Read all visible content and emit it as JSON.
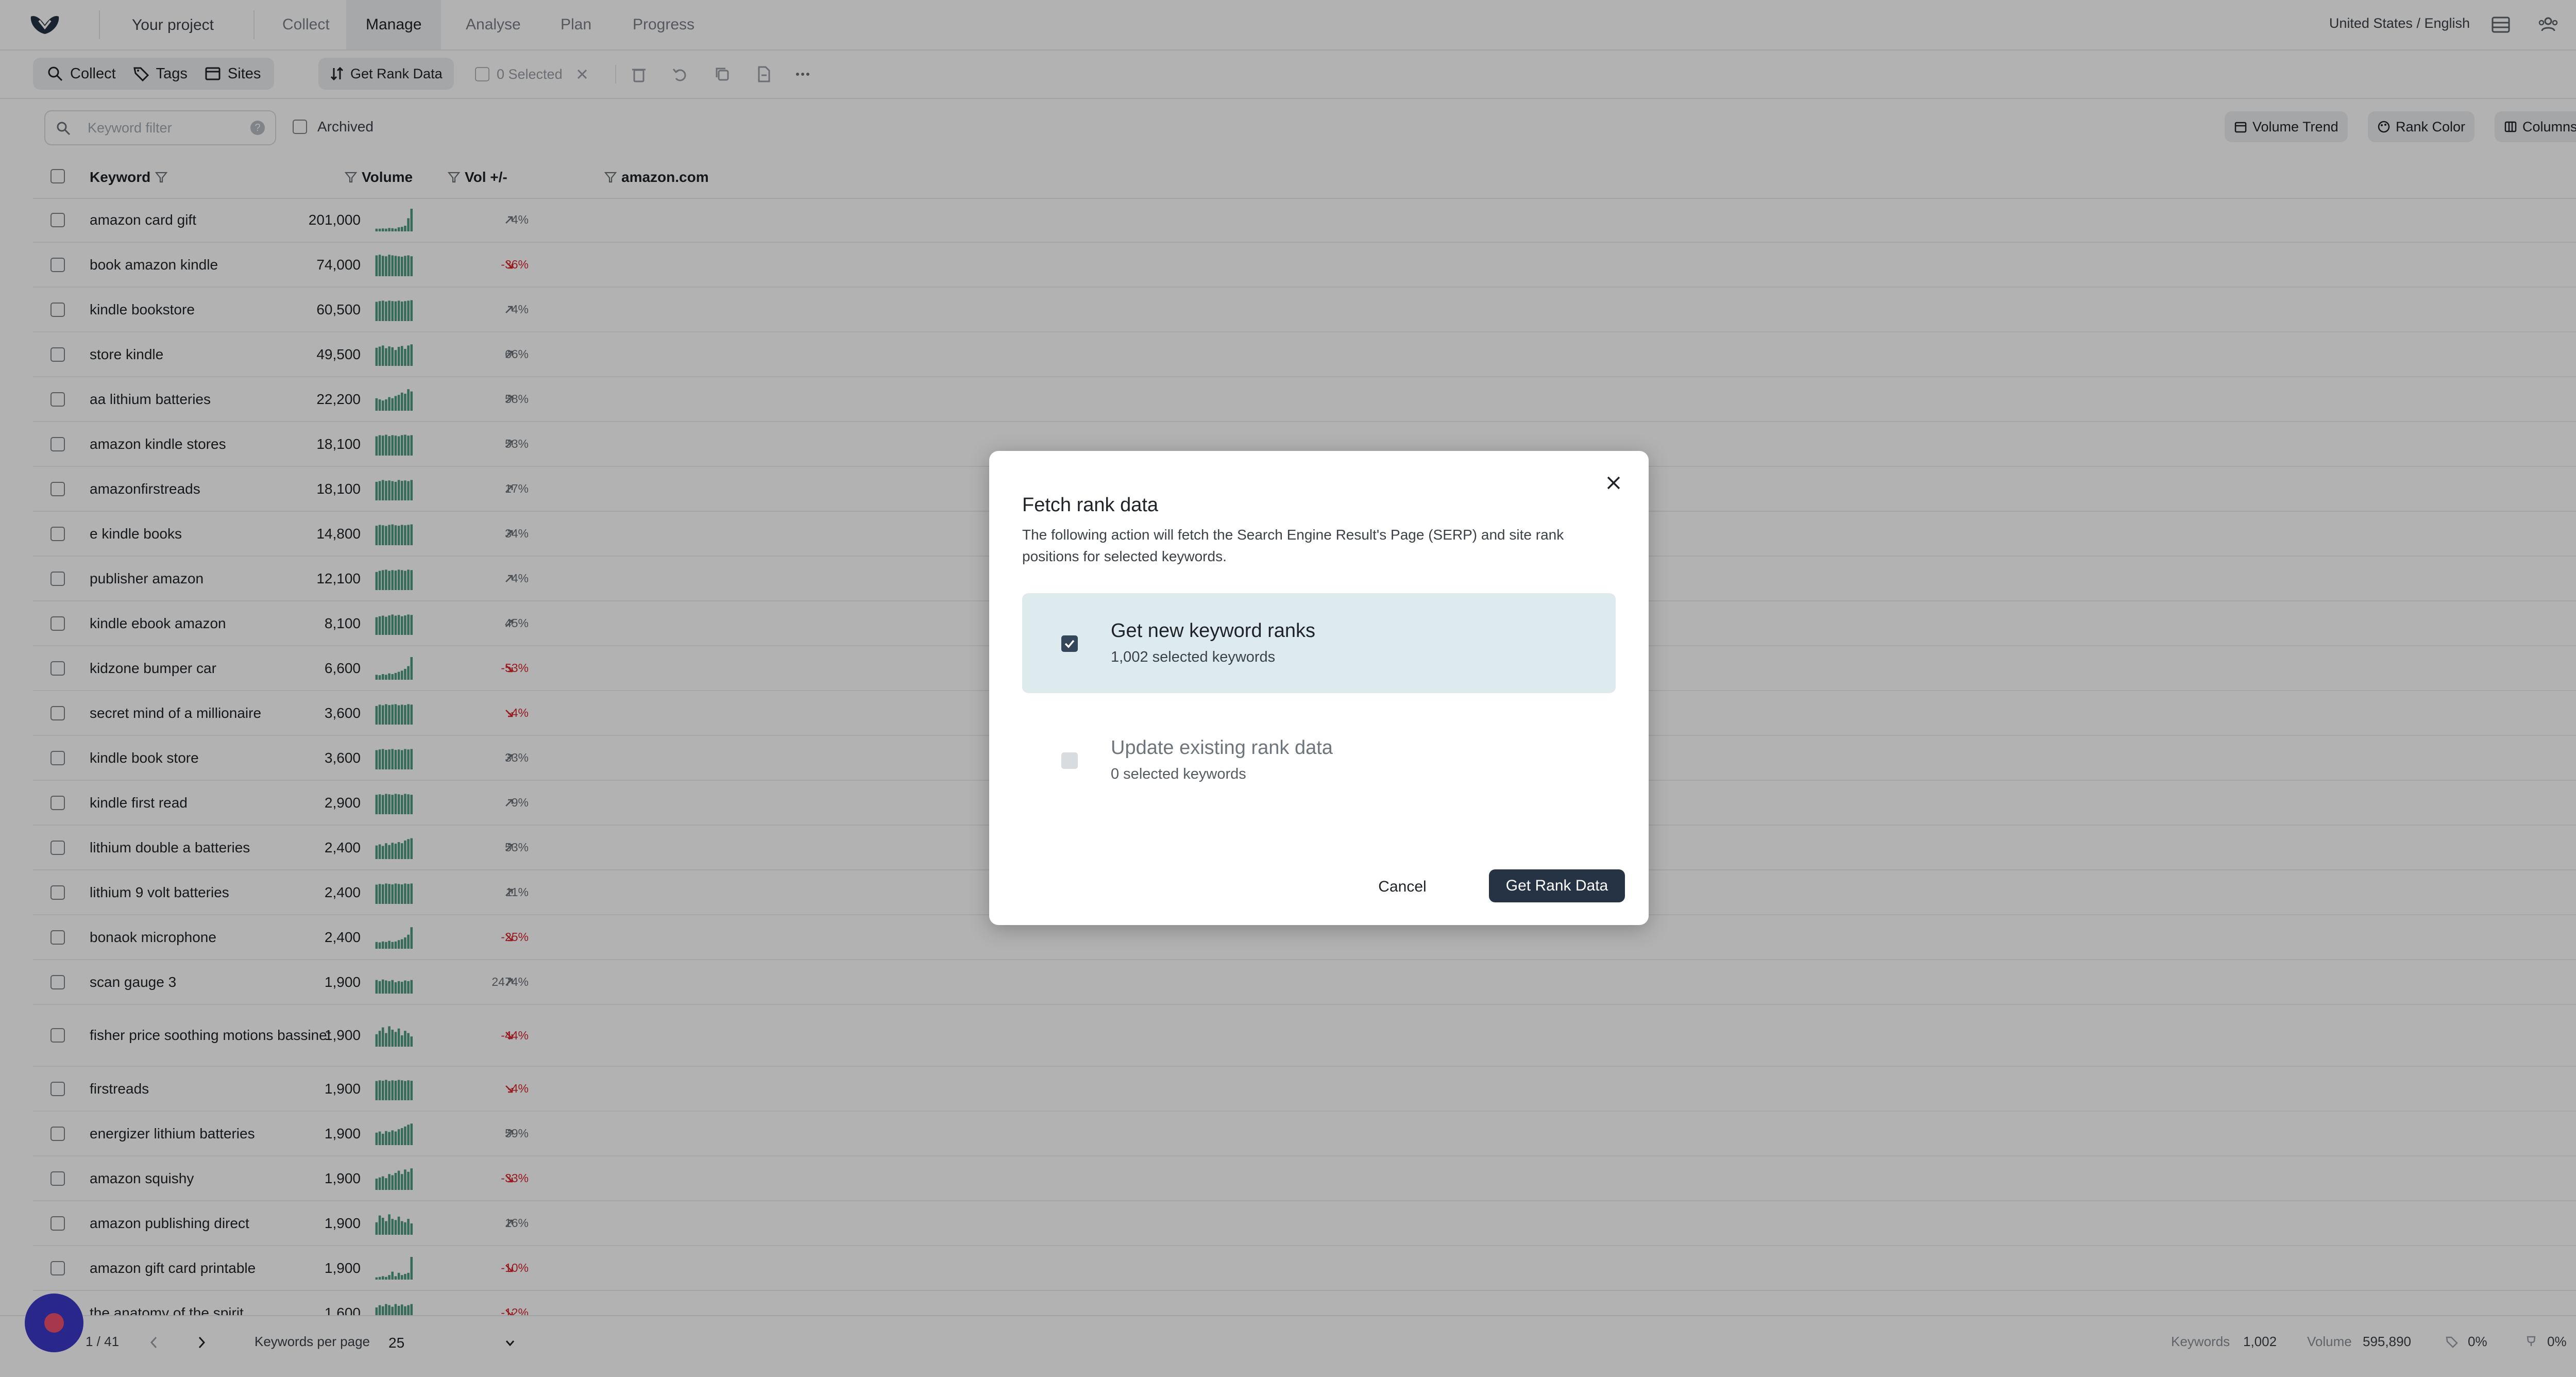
{
  "app": {
    "project_label": "Your project",
    "nav_tabs": [
      {
        "label": "Collect",
        "active": false
      },
      {
        "label": "Manage",
        "active": true
      },
      {
        "label": "Analyse",
        "active": false
      },
      {
        "label": "Plan",
        "active": false
      },
      {
        "label": "Progress",
        "active": false
      }
    ],
    "locale": "United States / English",
    "icons": [
      "logo-icon",
      "layout-icon",
      "team-icon",
      "settings-icon"
    ]
  },
  "toolbar": {
    "collect_label": "Collect",
    "tags_label": "Tags",
    "sites_label": "Sites",
    "get_rank_data_label": "Get Rank Data",
    "selected_label": "0 Selected"
  },
  "filter": {
    "placeholder": "Keyword filter",
    "archived_label": "Archived",
    "volume_trend_label": "Volume Trend",
    "rank_color_label": "Rank Color",
    "columns_label": "Columns"
  },
  "table": {
    "headers": {
      "keyword": "Keyword",
      "volume": "Volume",
      "vol_change": "Vol +/-",
      "site": "amazon.com"
    },
    "colors": {
      "spark": "#4f9a80",
      "negative": "#d9262f",
      "neutral": "#6b7279"
    },
    "rows": [
      {
        "keyword": "amazon card gift",
        "volume": "201,000",
        "change": "4%",
        "trend": "up",
        "spark": [
          0.12,
          0.12,
          0.13,
          0.12,
          0.15,
          0.14,
          0.12,
          0.18,
          0.2,
          0.25,
          0.58,
          1.0
        ]
      },
      {
        "keyword": "book amazon kindle",
        "volume": "74,000",
        "change": "-36%",
        "trend": "down",
        "spark": [
          0.92,
          0.95,
          0.9,
          0.88,
          0.95,
          0.92,
          0.9,
          0.88,
          0.86,
          0.9,
          0.92,
          0.88
        ]
      },
      {
        "keyword": "kindle bookstore",
        "volume": "60,500",
        "change": "4%",
        "trend": "up",
        "spark": [
          0.85,
          0.88,
          0.9,
          0.86,
          0.9,
          0.88,
          0.87,
          0.9,
          0.86,
          0.88,
          0.9,
          0.92
        ]
      },
      {
        "keyword": "store kindle",
        "volume": "49,500",
        "change": "66%",
        "trend": "up",
        "spark": [
          0.8,
          0.85,
          0.9,
          0.78,
          0.86,
          0.82,
          0.7,
          0.84,
          0.88,
          0.75,
          0.9,
          0.95
        ]
      },
      {
        "keyword": "aa lithium batteries",
        "volume": "22,200",
        "change": "58%",
        "trend": "up",
        "spark": [
          0.55,
          0.5,
          0.45,
          0.5,
          0.6,
          0.55,
          0.65,
          0.7,
          0.8,
          0.75,
          0.95,
          0.85
        ]
      },
      {
        "keyword": "amazon kindle stores",
        "volume": "18,100",
        "change": "53%",
        "trend": "up",
        "spark": [
          0.85,
          0.9,
          0.88,
          0.92,
          0.86,
          0.9,
          0.88,
          0.85,
          0.9,
          0.92,
          0.88,
          0.9
        ]
      },
      {
        "keyword": "amazonfirstreads",
        "volume": "18,100",
        "change": "17%",
        "trend": "up",
        "spark": [
          0.82,
          0.85,
          0.9,
          0.86,
          0.88,
          0.85,
          0.82,
          0.9,
          0.86,
          0.88,
          0.85,
          0.9
        ]
      },
      {
        "keyword": "e kindle books",
        "volume": "14,800",
        "change": "34%",
        "trend": "up",
        "spark": [
          0.86,
          0.9,
          0.88,
          0.85,
          0.9,
          0.92,
          0.88,
          0.86,
          0.9,
          0.88,
          0.9,
          0.92
        ]
      },
      {
        "keyword": "publisher amazon",
        "volume": "12,100",
        "change": "4%",
        "trend": "up",
        "spark": [
          0.8,
          0.85,
          0.88,
          0.9,
          0.85,
          0.88,
          0.86,
          0.9,
          0.88,
          0.85,
          0.9,
          0.88
        ]
      },
      {
        "keyword": "kindle ebook amazon",
        "volume": "8,100",
        "change": "45%",
        "trend": "up",
        "spark": [
          0.78,
          0.82,
          0.85,
          0.8,
          0.86,
          0.9,
          0.85,
          0.88,
          0.82,
          0.86,
          0.9,
          0.88
        ]
      },
      {
        "keyword": "kidzone bumper car",
        "volume": "6,600",
        "change": "-53%",
        "trend": "down",
        "spark": [
          0.22,
          0.2,
          0.25,
          0.22,
          0.28,
          0.25,
          0.3,
          0.35,
          0.4,
          0.48,
          0.6,
          1.0
        ]
      },
      {
        "keyword": "secret mind of a millionaire",
        "volume": "3,600",
        "change": "-4%",
        "trend": "down",
        "spark": [
          0.82,
          0.88,
          0.85,
          0.9,
          0.86,
          0.88,
          0.9,
          0.85,
          0.88,
          0.86,
          0.9,
          0.88
        ]
      },
      {
        "keyword": "kindle book store",
        "volume": "3,600",
        "change": "33%",
        "trend": "up",
        "spark": [
          0.85,
          0.88,
          0.9,
          0.86,
          0.88,
          0.9,
          0.86,
          0.88,
          0.85,
          0.9,
          0.88,
          0.9
        ]
      },
      {
        "keyword": "kindle first read",
        "volume": "2,900",
        "change": "9%",
        "trend": "up",
        "spark": [
          0.86,
          0.88,
          0.85,
          0.9,
          0.88,
          0.86,
          0.9,
          0.88,
          0.85,
          0.9,
          0.88,
          0.86
        ]
      },
      {
        "keyword": "lithium double a batteries",
        "volume": "2,400",
        "change": "53%",
        "trend": "up",
        "spark": [
          0.6,
          0.65,
          0.58,
          0.7,
          0.62,
          0.72,
          0.68,
          0.75,
          0.7,
          0.82,
          0.88,
          0.92
        ]
      },
      {
        "keyword": "lithium 9 volt batteries",
        "volume": "2,400",
        "change": "11%",
        "trend": "up",
        "spark": [
          0.85,
          0.88,
          0.86,
          0.9,
          0.88,
          0.86,
          0.9,
          0.88,
          0.86,
          0.9,
          0.88,
          0.9
        ]
      },
      {
        "keyword": "bonaok microphone",
        "volume": "2,400",
        "change": "-25%",
        "trend": "down",
        "spark": [
          0.3,
          0.28,
          0.32,
          0.3,
          0.35,
          0.3,
          0.32,
          0.38,
          0.42,
          0.5,
          0.62,
          0.95
        ]
      },
      {
        "keyword": "scan gauge 3",
        "volume": "1,900",
        "change": "2474%",
        "trend": "up",
        "spark": [
          0.6,
          0.55,
          0.62,
          0.58,
          0.55,
          0.6,
          0.5,
          0.55,
          0.52,
          0.58,
          0.55,
          0.6
        ]
      },
      {
        "keyword": "fisher price soothing motions bassinet",
        "volume": "1,900",
        "change": "-44%",
        "trend": "down",
        "spark": [
          0.55,
          0.7,
          0.85,
          0.6,
          0.9,
          0.75,
          0.65,
          0.8,
          0.5,
          0.7,
          0.6,
          0.45
        ]
      },
      {
        "keyword": "firstreads",
        "volume": "1,900",
        "change": "-4%",
        "trend": "down",
        "spark": [
          0.85,
          0.88,
          0.86,
          0.9,
          0.85,
          0.88,
          0.86,
          0.9,
          0.88,
          0.85,
          0.88,
          0.86
        ]
      },
      {
        "keyword": "energizer lithium batteries",
        "volume": "1,900",
        "change": "59%",
        "trend": "up",
        "spark": [
          0.55,
          0.6,
          0.5,
          0.62,
          0.58,
          0.65,
          0.6,
          0.7,
          0.75,
          0.82,
          0.9,
          0.95
        ]
      },
      {
        "keyword": "amazon squishy",
        "volume": "1,900",
        "change": "-33%",
        "trend": "down",
        "spark": [
          0.5,
          0.55,
          0.6,
          0.52,
          0.7,
          0.65,
          0.75,
          0.85,
          0.7,
          0.9,
          0.8,
          0.95
        ]
      },
      {
        "keyword": "amazon publishing direct",
        "volume": "1,900",
        "change": "16%",
        "trend": "up",
        "spark": [
          0.55,
          0.85,
          0.75,
          0.6,
          0.9,
          0.7,
          0.65,
          0.8,
          0.6,
          0.55,
          0.7,
          0.5
        ]
      },
      {
        "keyword": "amazon gift card printable",
        "volume": "1,900",
        "change": "-10%",
        "trend": "down",
        "spark": [
          0.1,
          0.12,
          0.15,
          0.12,
          0.2,
          0.35,
          0.15,
          0.3,
          0.2,
          0.25,
          0.3,
          1.0
        ]
      },
      {
        "keyword": "the anatomy of the spirit",
        "volume": "1,600",
        "change": "-12%",
        "trend": "down",
        "spark": [
          0.75,
          0.85,
          0.8,
          0.9,
          0.85,
          0.78,
          0.9,
          0.82,
          0.88,
          0.8,
          0.85,
          0.9
        ]
      }
    ]
  },
  "footer": {
    "page_label": "1 / 41",
    "per_page_label": "Keywords per page",
    "per_page_value": "25",
    "keywords_label": "Keywords",
    "keywords_value": "1,002",
    "volume_label": "Volume",
    "volume_value": "595,890",
    "tag_pct": "0%",
    "filter_pct": "0%"
  },
  "modal": {
    "title": "Fetch rank data",
    "description": "The following action will fetch the Search Engine Result's Page (SERP) and site rank positions for selected keywords.",
    "options": [
      {
        "title": "Get new keyword ranks",
        "subtitle": "1,002 selected keywords",
        "checked": true
      },
      {
        "title": "Update existing rank data",
        "subtitle": "0 selected keywords",
        "checked": false
      }
    ],
    "cancel_label": "Cancel",
    "submit_label": "Get Rank Data"
  }
}
